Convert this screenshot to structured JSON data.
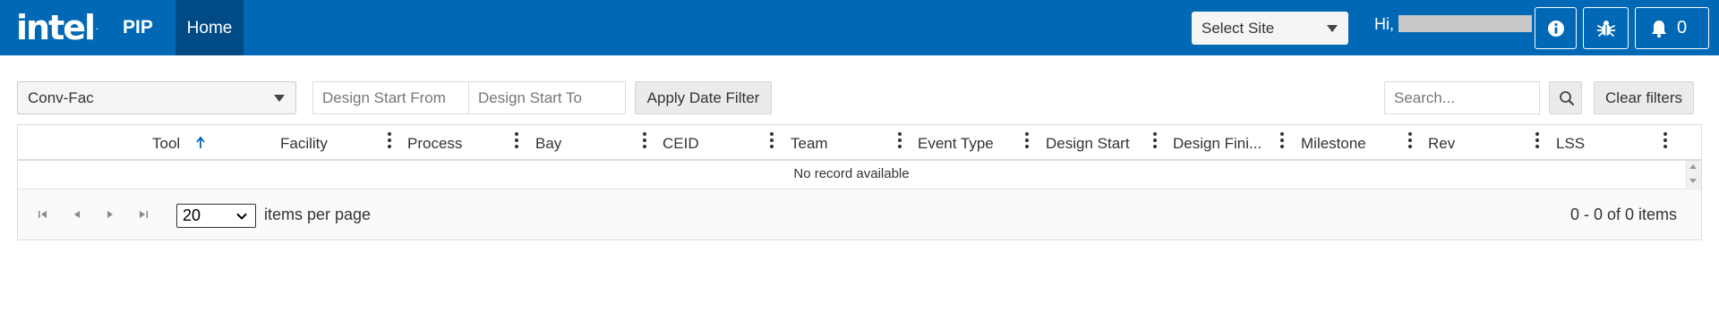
{
  "header": {
    "logo_text": "intel",
    "logo_mark": ".",
    "app_name": "PIP",
    "home_tab": "Home",
    "site_select": "Select Site",
    "greeting": "Hi,",
    "notification_count": "0",
    "brand_color": "#0068b5",
    "active_tab_color": "#004a86"
  },
  "toolbar": {
    "selected_view": "Conv-Fac",
    "date_from_placeholder": "Design Start From",
    "date_to_placeholder": "Design Start To",
    "apply_label": "Apply Date Filter",
    "search_placeholder": "Search...",
    "clear_label": "Clear filters"
  },
  "grid": {
    "columns": [
      "Tool",
      "Facility",
      "Process",
      "Bay",
      "CEID",
      "Team",
      "Event Type",
      "Design Start",
      "Design Fini...",
      "Milestone",
      "Rev",
      "LSS"
    ],
    "sorted_column": "Tool",
    "sort_direction": "ascending",
    "empty_message": "No record available",
    "sort_icon_color": "#0068b5"
  },
  "pager": {
    "page_size": "20",
    "items_per_page_label": "items per page",
    "range_text": "0 - 0 of 0 items"
  }
}
